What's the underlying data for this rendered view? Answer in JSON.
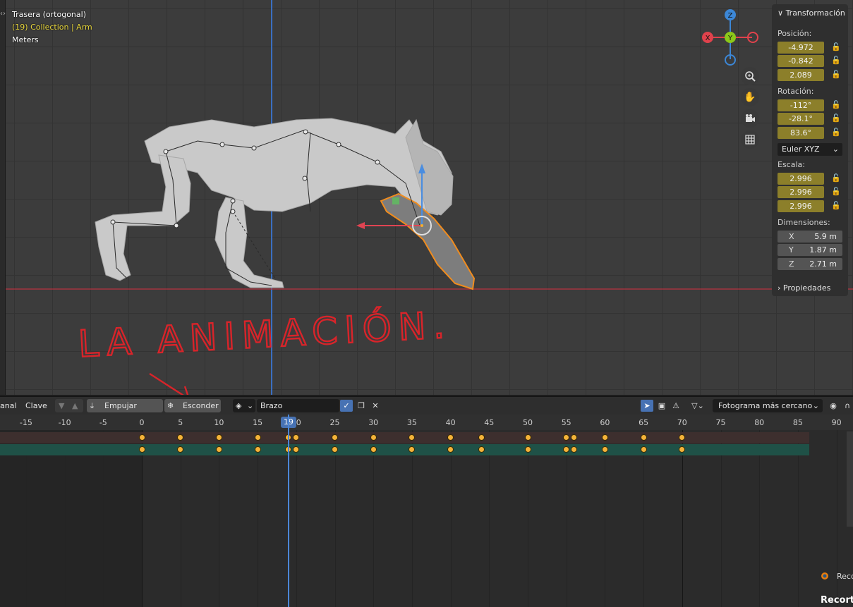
{
  "viewport": {
    "view_name": "Trasera (ortogonal)",
    "collection_line": "(19) Collection | Arm",
    "units": "Meters"
  },
  "gizmo": {
    "x_label": "X",
    "y_label": "Y",
    "z_label": "Z",
    "colors": {
      "x": "#e0424c",
      "y": "#8bc81a",
      "z": "#3c87d6"
    }
  },
  "nav_icons": [
    "zoom-icon",
    "hand-pan-icon",
    "camera-icon",
    "grid-icon"
  ],
  "transform_panel": {
    "title": "Transformación",
    "position_label": "Posición:",
    "position": [
      "-4.972",
      "-0.842",
      "2.089"
    ],
    "rotation_label": "Rotación:",
    "rotation": [
      "-112°",
      "-28.1°",
      "83.6°"
    ],
    "rotation_mode": "Euler XYZ",
    "scale_label": "Escala:",
    "scale": [
      "2.996",
      "2.996",
      "2.996"
    ],
    "dimensions_label": "Dimensiones:",
    "dimensions": [
      {
        "axis": "X",
        "value": "5.9 m"
      },
      {
        "axis": "Y",
        "value": "1.87 m"
      },
      {
        "axis": "Z",
        "value": "2.71 m"
      }
    ],
    "properties_label": "Propiedades"
  },
  "annotation": {
    "text": "LA ANIMACIÓN."
  },
  "timeline_header": {
    "canal": "anal",
    "clave": "Clave",
    "push_down": "Empujar debajo",
    "stash": "Esconder",
    "action_name": "Brazo",
    "snapping": "Fotograma más cercano"
  },
  "timeline": {
    "current_frame": "19",
    "ticks": [
      "-15",
      "-10",
      "-5",
      "0",
      "5",
      "10",
      "15",
      "20",
      "25",
      "30",
      "35",
      "40",
      "45",
      "50",
      "55",
      "60",
      "65",
      "70",
      "75",
      "80",
      "85",
      "90"
    ],
    "keyframes": [
      0,
      5,
      10,
      15,
      19,
      20,
      25,
      30,
      35,
      40,
      44,
      50,
      55,
      56,
      60,
      65,
      70
    ]
  },
  "footer": {
    "recorte_short": "Reco",
    "recorte": "Recorte"
  }
}
